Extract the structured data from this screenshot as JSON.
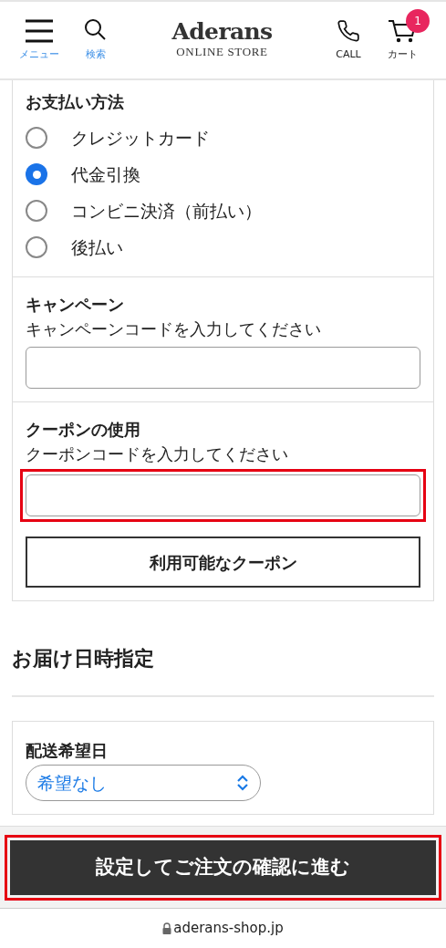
{
  "header": {
    "menu_label": "メニュー",
    "search_label": "検索",
    "logo_title": "Aderans",
    "logo_subtitle": "ONLINE STORE",
    "call_label": "CALL",
    "cart_label": "カート",
    "cart_count": "1"
  },
  "payment": {
    "title": "お支払い方法",
    "options": [
      {
        "label": "クレジットカード",
        "selected": false
      },
      {
        "label": "代金引換",
        "selected": true
      },
      {
        "label": "コンビニ決済（前払い）",
        "selected": false
      },
      {
        "label": "後払い",
        "selected": false
      }
    ]
  },
  "campaign": {
    "title": "キャンペーン",
    "hint": "キャンペーンコードを入力してください",
    "highlighted": false
  },
  "coupon": {
    "title": "クーポンの使用",
    "hint": "クーポンコードを入力してください",
    "highlighted": true,
    "button": "利用可能なクーポン"
  },
  "delivery": {
    "title": "お届け日時指定",
    "date_label": "配送希望日",
    "date_value": "希望なし"
  },
  "submit": {
    "label": "設定してご注文の確認に進む",
    "highlighted": true
  },
  "address_bar": {
    "url": "aderans-shop.jp"
  }
}
